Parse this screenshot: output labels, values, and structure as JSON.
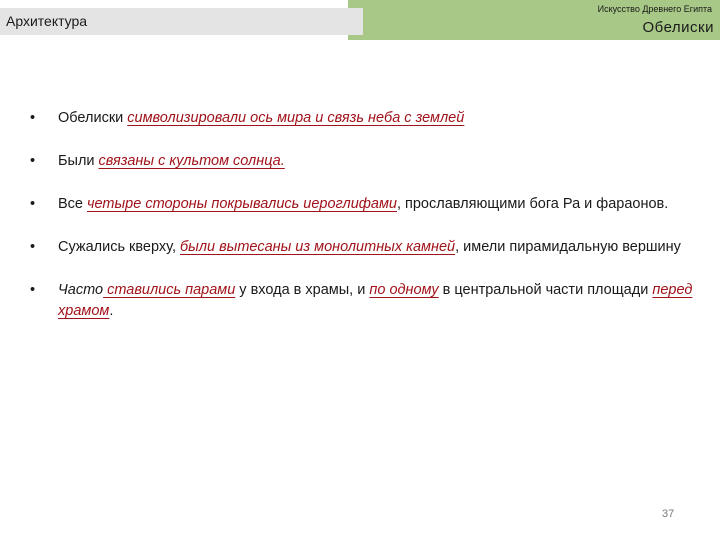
{
  "header": {
    "section": "Архитектура",
    "subject": "Искусство Древнего Египта",
    "topic": "Обелиски"
  },
  "bullets": [
    {
      "t1": "Обелиски ",
      "h1": "символизировали ось мира и связь неба с землей"
    },
    {
      "t1": "Были ",
      "h1": "связаны с культом солнца."
    },
    {
      "t1": "Все ",
      "h1": "четыре стороны покрывались иероглифами",
      "t2": ", прославляющими бога Ра и фараонов."
    },
    {
      "t1": "Сужались кверху, ",
      "h1": "были вытесаны из монолитных камней",
      "t2": ", имели пирамидальную вершину"
    },
    {
      "i1": "Часто",
      "h1": " ставились парами",
      "t2": " у входа в храмы, и ",
      "h2": "по одному",
      "t3": " в центральной части площади ",
      "h3": "перед храмом",
      "t4": "."
    }
  ],
  "bullet_symbol": "•",
  "page_number": "37"
}
